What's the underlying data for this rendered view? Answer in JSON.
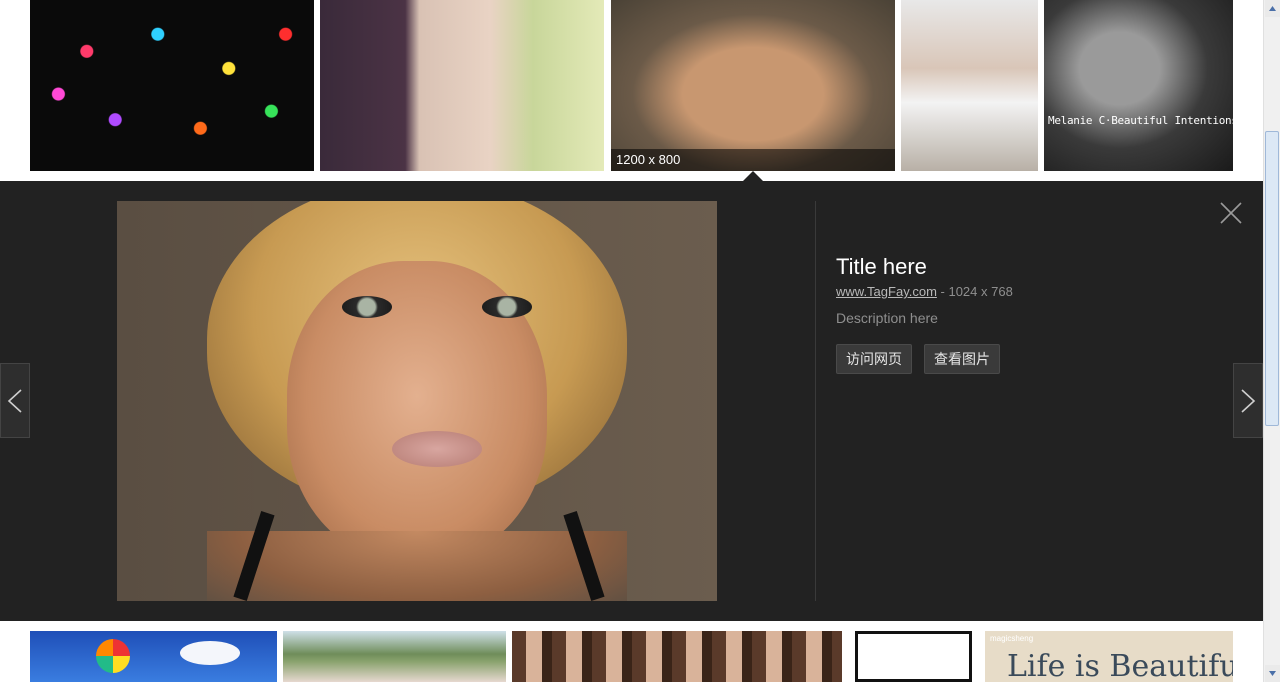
{
  "top_row": {
    "thumbnails": [
      {
        "subject": "flower-lights"
      },
      {
        "subject": "woman-dark-hair"
      },
      {
        "subject": "woman-blonde",
        "size_label": "1200 x 800"
      },
      {
        "subject": "girl-smiling"
      },
      {
        "subject": "woman-bw",
        "caption": "Melanie C·Beautiful Intentions"
      }
    ]
  },
  "preview": {
    "title": "Title here",
    "site_link": "www.TagFay.com",
    "dimensions": " - 1024 x 768",
    "description": "Description here",
    "visit_button": "访问网页",
    "view_button": "查看图片"
  },
  "bottom_row": {
    "thumbnails": [
      {
        "subject": "hot-air-balloon"
      },
      {
        "subject": "coast"
      },
      {
        "subject": "group-photo"
      },
      {
        "subject": "frame-sketch"
      },
      {
        "subject": "life-is-beautiful",
        "small_label": "magicsheng",
        "caption": "Life is Beautiful"
      }
    ]
  },
  "icons": {
    "close": "close-icon",
    "prev": "chevron-left-icon",
    "next": "chevron-right-icon"
  },
  "colors": {
    "preview_background": "#222222",
    "title": "#ffffff",
    "meta": "#8f8f8f"
  }
}
